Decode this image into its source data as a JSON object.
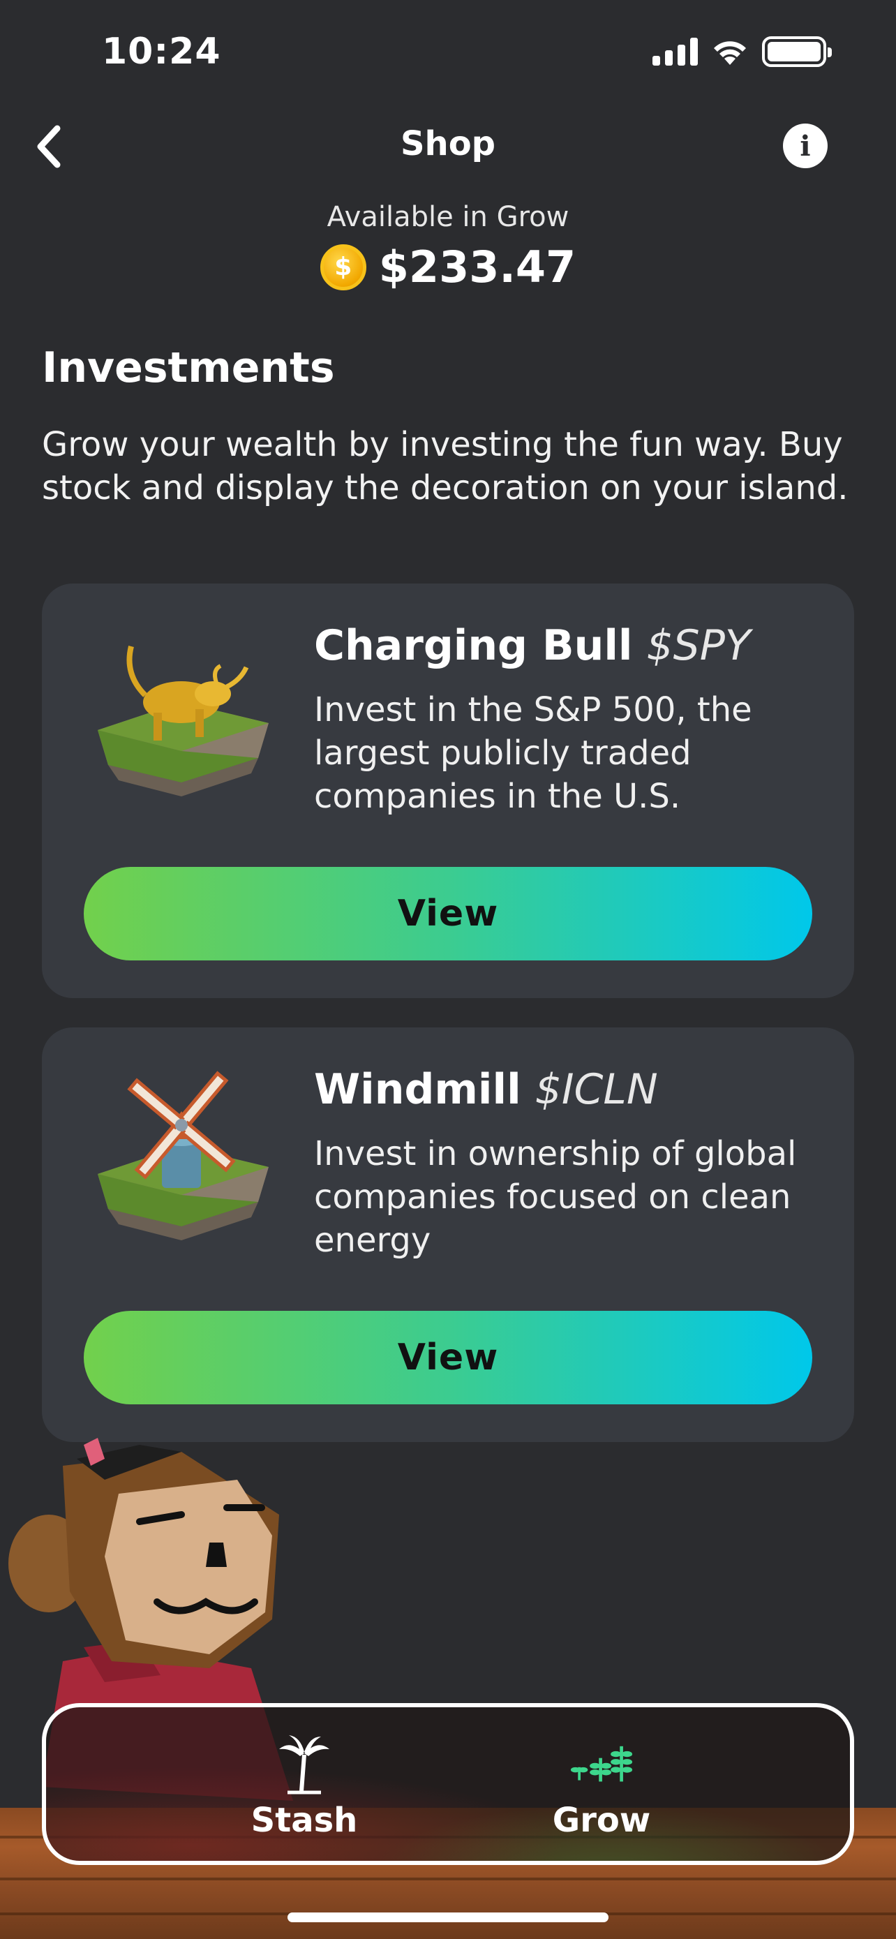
{
  "status_bar": {
    "time": "10:24"
  },
  "header": {
    "title": "Shop"
  },
  "balance": {
    "label": "Available in Grow",
    "coin_symbol": "$",
    "amount": "$233.47"
  },
  "section": {
    "title": "Investments",
    "description": "Grow your wealth by investing the fun way. Buy stock and display the decoration on your island."
  },
  "cards": [
    {
      "name": "Charging Bull",
      "ticker": "$SPY",
      "description": "Invest in the S&P 500, the largest publicly traded companies in the U.S.",
      "button_label": "View"
    },
    {
      "name": "Windmill",
      "ticker": "$ICLN",
      "description": "Invest in ownership of global companies focused on clean energy",
      "button_label": "View"
    }
  ],
  "tab_bar": {
    "tabs": [
      {
        "label": "Stash",
        "icon": "palm-tree-icon"
      },
      {
        "label": "Grow",
        "icon": "sprouts-icon"
      }
    ]
  },
  "colors": {
    "background": "#2b2c2f",
    "card": "#373a40",
    "button_gradient_start": "#72d04c",
    "button_gradient_end": "#00c8ea",
    "coin": "#f2a800"
  }
}
